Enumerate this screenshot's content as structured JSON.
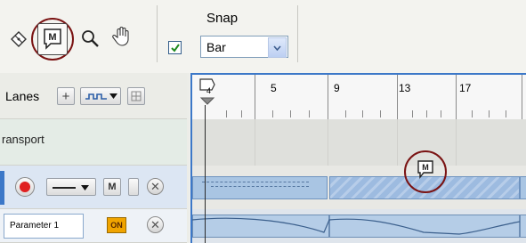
{
  "toolbar": {
    "tools": [
      {
        "name": "eraser",
        "icon": "eraser-icon"
      },
      {
        "name": "marker",
        "icon": "marker-icon"
      },
      {
        "name": "zoom",
        "icon": "zoom-icon"
      },
      {
        "name": "hand",
        "icon": "hand-icon"
      }
    ],
    "snap_label": "Snap",
    "snap_checked": true,
    "snap_value": "Bar"
  },
  "left_panel": {
    "lanes_label": "Lanes",
    "transport_label": "ransport",
    "parameter_label": "Parameter 1",
    "on_label": "ON",
    "mute_label": "M"
  },
  "ruler": {
    "bars": [
      "5",
      "9",
      "13",
      "17"
    ],
    "marker_beat": "4"
  },
  "lane_marker_label": "M",
  "colors": {
    "accent": "#3c78c8",
    "highlight_circle": "#7a1313",
    "record": "#e02020",
    "on_badge": "#f0a400"
  }
}
